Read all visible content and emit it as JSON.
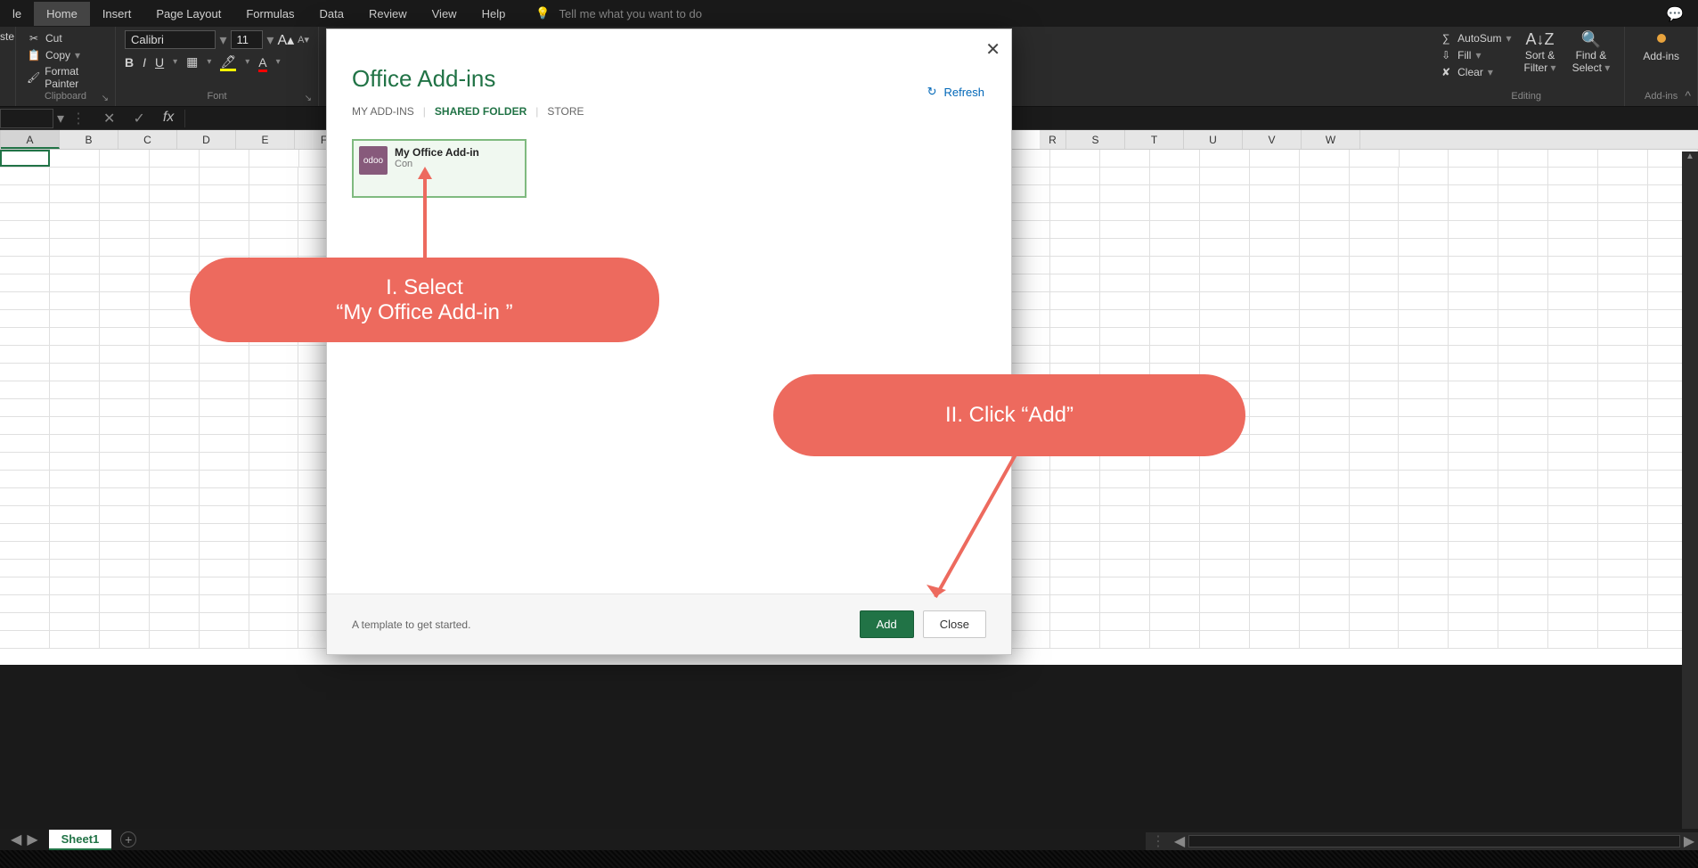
{
  "menu": {
    "items": [
      "le",
      "Home",
      "Insert",
      "Page Layout",
      "Formulas",
      "Data",
      "Review",
      "View",
      "Help"
    ],
    "active": "Home",
    "tell_me": "Tell me what you want to do"
  },
  "clipboard": {
    "cut": "Cut",
    "copy": "Copy",
    "fp": "Format Painter",
    "label": "Clipboard",
    "paste_stub": "ste"
  },
  "font": {
    "name": "Calibri",
    "size": "11",
    "label": "Font"
  },
  "editing": {
    "autosum": "AutoSum",
    "fill": "Fill",
    "clear": "Clear",
    "sortfilter_l1": "Sort &",
    "sortfilter_l2": "Filter",
    "findsel_l1": "Find &",
    "findsel_l2": "Select",
    "label": "Editing"
  },
  "addins_group": {
    "btn": "Add-ins",
    "label": "Add-ins"
  },
  "columns": [
    "A",
    "B",
    "C",
    "D",
    "E",
    "F",
    "",
    "",
    "",
    "",
    "",
    "",
    "",
    "",
    "",
    "",
    "",
    "",
    "R",
    "S",
    "T",
    "U",
    "V",
    "W"
  ],
  "sheet": {
    "name": "Sheet1"
  },
  "dialog": {
    "title": "Office Add-ins",
    "refresh": "Refresh",
    "tabs": {
      "my": "MY ADD-INS",
      "shared": "SHARED FOLDER",
      "store": "STORE"
    },
    "addin": {
      "name": "My Office Add-in",
      "sub": "Con",
      "logo": "odoo"
    },
    "footer_text": "A template to get started.",
    "add": "Add",
    "close": "Close"
  },
  "callouts": {
    "c1a": "I. Select",
    "c1b": "“My Office Add-in ”",
    "c2": "II. Click “Add”"
  }
}
